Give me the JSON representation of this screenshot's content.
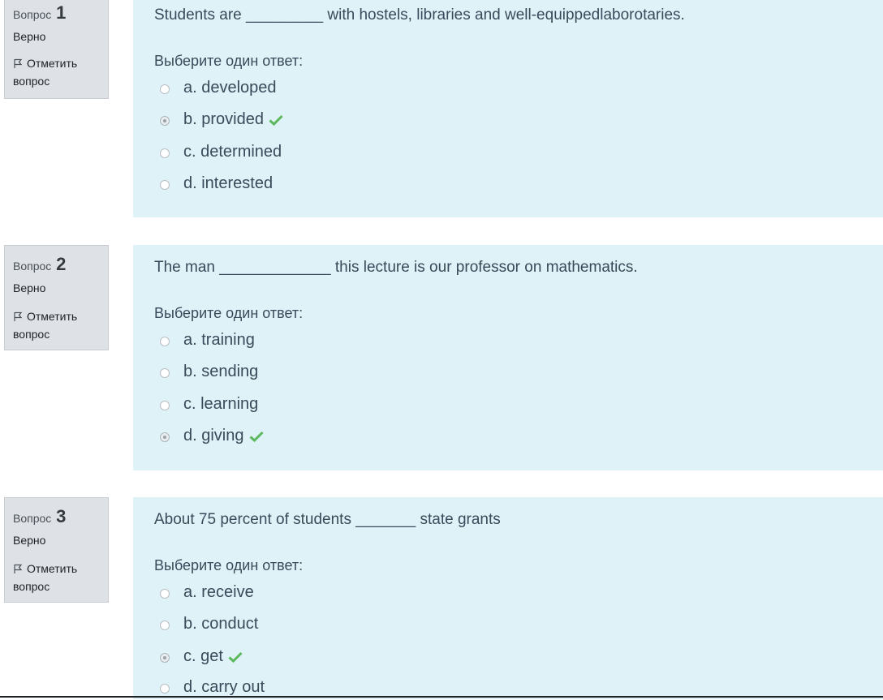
{
  "questions": [
    {
      "label": "Вопрос",
      "number": "1",
      "state": "Верно",
      "flag_label": "Отметить вопрос",
      "text": "Students are _________ with hostels, libraries and well-equippedlaborotaries.",
      "prompt": "Выберите один ответ:",
      "answers": [
        {
          "label": "a. developed",
          "checked": false,
          "correct": false
        },
        {
          "label": "b. provided",
          "checked": true,
          "correct": true
        },
        {
          "label": "c. determined",
          "checked": false,
          "correct": false
        },
        {
          "label": "d. interested",
          "checked": false,
          "correct": false
        }
      ]
    },
    {
      "label": "Вопрос",
      "number": "2",
      "state": "Верно",
      "flag_label": "Отметить вопрос",
      "text": "The man _____________ this lecture is our professor on mathematics.",
      "prompt": "Выберите один ответ:",
      "answers": [
        {
          "label": "a. training",
          "checked": false,
          "correct": false
        },
        {
          "label": "b. sending",
          "checked": false,
          "correct": false
        },
        {
          "label": "c. learning",
          "checked": false,
          "correct": false
        },
        {
          "label": "d. giving",
          "checked": true,
          "correct": true
        }
      ]
    },
    {
      "label": "Вопрос",
      "number": "3",
      "state": "Верно",
      "flag_label": "Отметить вопрос",
      "text": "About 75 percent of students _______ state grants",
      "prompt": "Выберите один ответ:",
      "answers": [
        {
          "label": "a. receive",
          "checked": false,
          "correct": false
        },
        {
          "label": "b. conduct",
          "checked": false,
          "correct": false
        },
        {
          "label": "c. get",
          "checked": true,
          "correct": true
        },
        {
          "label": "d. carry out",
          "checked": false,
          "correct": false
        }
      ]
    }
  ],
  "colors": {
    "content_bg": "#def2f8",
    "info_bg": "#dee2e6",
    "correct_check": "#5cb85c"
  },
  "icons": {
    "flag": "flag-icon",
    "correct": "check-icon"
  }
}
